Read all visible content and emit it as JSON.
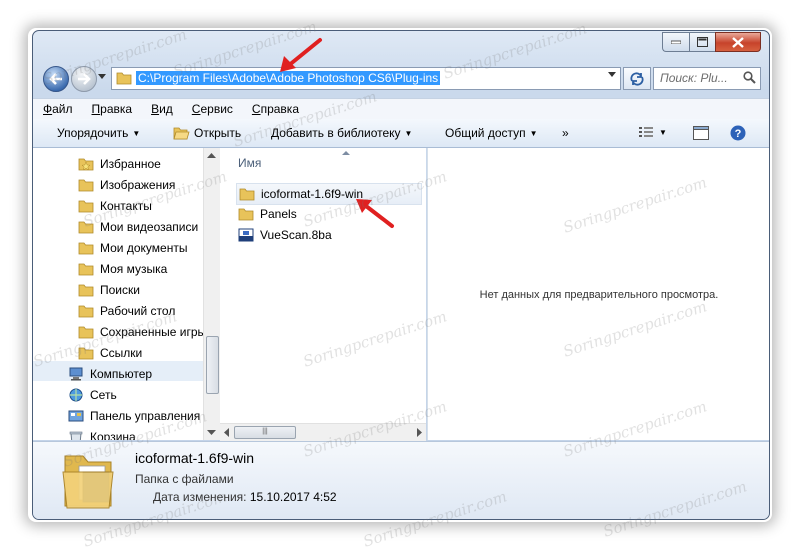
{
  "window": {
    "caption_buttons": [
      "minimize",
      "maximize",
      "close"
    ]
  },
  "address_bar": {
    "path": "C:\\Program Files\\Adobe\\Adobe Photoshop CS6\\Plug-ins"
  },
  "search": {
    "placeholder": "Поиск: Plu..."
  },
  "menu": [
    "Файл",
    "Правка",
    "Вид",
    "Сервис",
    "Справка"
  ],
  "toolbar": {
    "organize": "Упорядочить",
    "open": "Открыть",
    "add_library": "Добавить в библиотеку",
    "share": "Общий доступ",
    "more": "»"
  },
  "nav_pane": {
    "items": [
      {
        "label": "Избранное",
        "icon": "favorites-folder-icon"
      },
      {
        "label": "Изображения",
        "icon": "folder-icon"
      },
      {
        "label": "Контакты",
        "icon": "folder-icon"
      },
      {
        "label": "Мои видеозаписи",
        "icon": "folder-icon"
      },
      {
        "label": "Мои документы",
        "icon": "folder-icon"
      },
      {
        "label": "Моя музыка",
        "icon": "folder-icon"
      },
      {
        "label": "Поиски",
        "icon": "folder-icon"
      },
      {
        "label": "Рабочий стол",
        "icon": "folder-icon"
      },
      {
        "label": "Сохраненные игры",
        "icon": "folder-icon"
      },
      {
        "label": "Ссылки",
        "icon": "folder-icon"
      },
      {
        "label": "Компьютер",
        "icon": "computer-icon"
      },
      {
        "label": "Сеть",
        "icon": "network-icon"
      },
      {
        "label": "Панель управления",
        "icon": "control-panel-icon"
      },
      {
        "label": "Корзина",
        "icon": "recycle-bin-icon"
      }
    ],
    "selected": "Компьютер"
  },
  "file_list": {
    "column": "Имя",
    "items": [
      {
        "name": "icoformat-1.6f9-win",
        "type": "folder",
        "selected": true
      },
      {
        "name": "Panels",
        "type": "folder",
        "selected": false
      },
      {
        "name": "VueScan.8ba",
        "type": "plugin-file",
        "selected": false
      }
    ]
  },
  "preview": {
    "text": "Нет данных для предварительного просмотра."
  },
  "details": {
    "name": "icoformat-1.6f9-win",
    "type": "Папка с файлами",
    "date_label": "Дата изменения:",
    "date_value": "15.10.2017 4:52"
  },
  "watermark": "Soringpcrepair.com",
  "colors": {
    "selection": "#3399ff",
    "annotation_arrow": "#e02020"
  }
}
